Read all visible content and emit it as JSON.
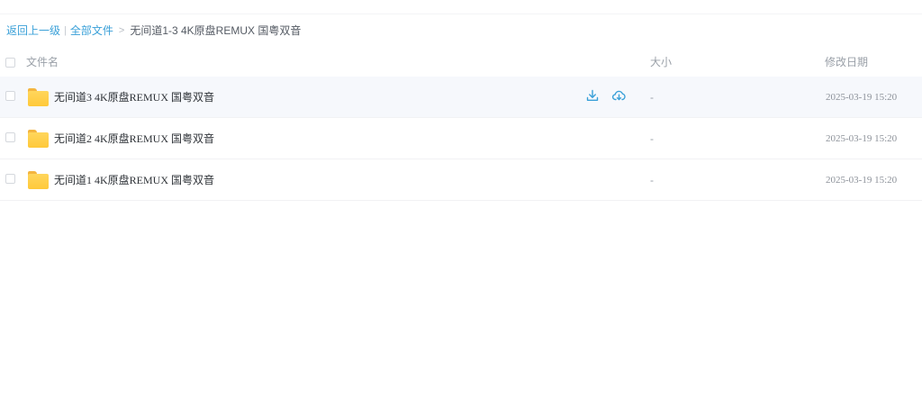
{
  "breadcrumb": {
    "back_label": "返回上一级",
    "separator": "|",
    "root_label": "全部文件",
    "arrow": ">",
    "current_label": "无间道1-3 4K原盘REMUX 国粤双音"
  },
  "table": {
    "columns": {
      "name": "文件名",
      "size": "大小",
      "modified": "修改日期"
    },
    "rows": [
      {
        "name": "无间道3 4K原盘REMUX 国粤双音",
        "size": "-",
        "modified": "2025-03-19 15:20",
        "icon": "folder-icon",
        "hovered": true
      },
      {
        "name": "无间道2 4K原盘REMUX 国粤双音",
        "size": "-",
        "modified": "2025-03-19 15:20",
        "icon": "folder-icon",
        "hovered": false
      },
      {
        "name": "无间道1 4K原盘REMUX 国粤双音",
        "size": "-",
        "modified": "2025-03-19 15:20",
        "icon": "folder-icon",
        "hovered": false
      }
    ],
    "row_actions": [
      "download-icon",
      "cloud-save-icon"
    ]
  },
  "colors": {
    "link": "#3aa0d8",
    "folder": "#ffc93a",
    "hover_row": "#f6f8fc",
    "action_icon": "#3aa0d8"
  }
}
